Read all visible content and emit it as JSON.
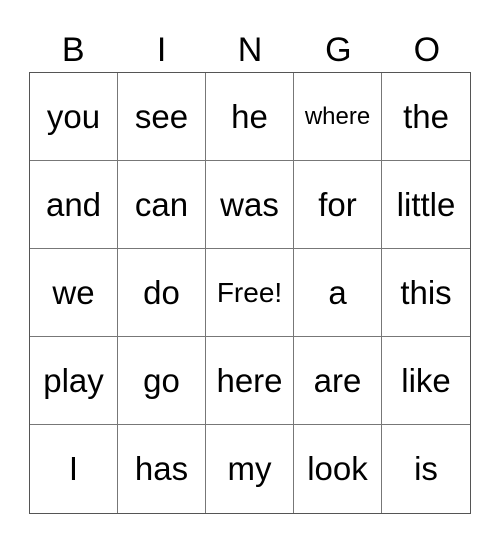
{
  "header": {
    "letters": [
      "B",
      "I",
      "N",
      "G",
      "O"
    ]
  },
  "board": {
    "rows": [
      [
        "you",
        "see",
        "he",
        "where",
        "the"
      ],
      [
        "and",
        "can",
        "was",
        "for",
        "little"
      ],
      [
        "we",
        "do",
        "Free!",
        "a",
        "this"
      ],
      [
        "play",
        "go",
        "here",
        "are",
        "like"
      ],
      [
        "I",
        "has",
        "my",
        "look",
        "is"
      ]
    ]
  },
  "colors": {
    "background": "#ffffff",
    "text": "#000000",
    "grid_line": "#666666"
  }
}
